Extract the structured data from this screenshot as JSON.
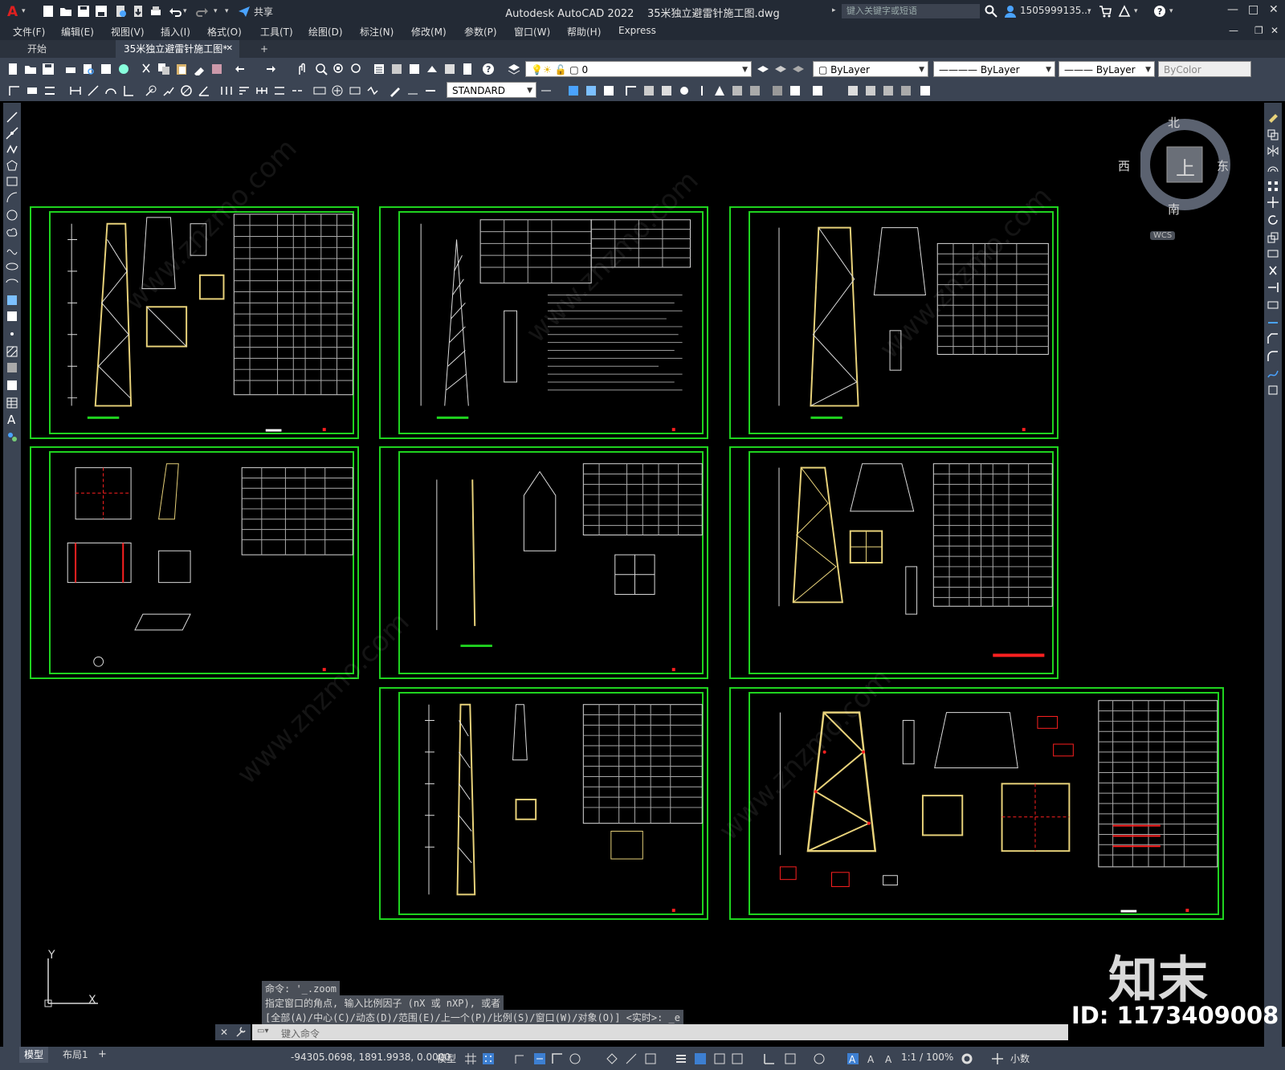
{
  "titlebar": {
    "app_title": "Autodesk AutoCAD 2022",
    "file_title": "35米独立避雷针施工图.dwg",
    "share_label": "共享",
    "search_placeholder": "键入关键字或短语",
    "user": "1505999135...",
    "minimize": "—",
    "restore": "□",
    "close": "✕"
  },
  "menubar": {
    "items": [
      "文件(F)",
      "编辑(E)",
      "视图(V)",
      "插入(I)",
      "格式(O)",
      "工具(T)",
      "绘图(D)",
      "标注(N)",
      "修改(M)",
      "参数(P)",
      "窗口(W)",
      "帮助(H)",
      "Express"
    ]
  },
  "tabs": {
    "start": "开始",
    "active": "35米独立避雷针施工图*",
    "add": "+"
  },
  "properties": {
    "layer": "0",
    "color": "ByLayer",
    "linetype": "ByLayer",
    "lineweight": "ByLayer",
    "plotstyle": "ByColor",
    "textstyle": "STANDARD"
  },
  "viewcube": {
    "north": "北",
    "south": "南",
    "east": "东",
    "west": "西",
    "top": "上",
    "wcs": "WCS"
  },
  "ucs": {
    "x": "X",
    "y": "Y"
  },
  "command": {
    "history1": "命令: '_.zoom",
    "history2": "指定窗口的角点, 输入比例因子 (nX 或 nXP), 或者",
    "history3": "[全部(A)/中心(C)/动态(D)/范围(E)/上一个(P)/比例(S)/窗口(W)/对象(O)] <实时>: _e",
    "placeholder": "键入命令"
  },
  "layout_tabs": [
    "模型",
    "布局1",
    "+"
  ],
  "statusbar": {
    "coords": "-94305.0698, 1891.9938, 0.0000",
    "model": "模型",
    "scale": "1:1 / 100%",
    "units": "小数"
  },
  "watermark": {
    "brand": "知末",
    "id": "ID: 1173409008"
  },
  "colors": {
    "sheet_border": "#1fd31f",
    "background": "#000000",
    "ui_dark": "#232a35",
    "ui_mid": "#3b4453",
    "tower_member": "#e8d27a",
    "red_mark": "#ff2020"
  }
}
